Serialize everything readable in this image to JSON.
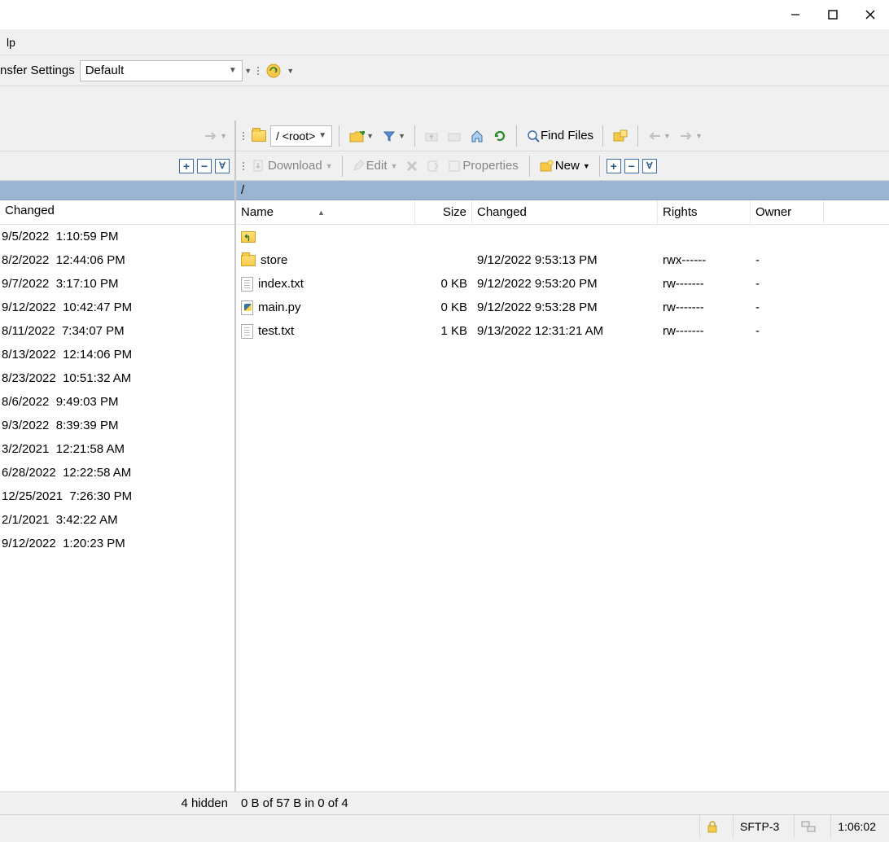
{
  "menu": {
    "help": "lp"
  },
  "toolbar": {
    "transfer_settings_label": "nsfer Settings",
    "transfer_settings_value": "Default"
  },
  "remote_nav": {
    "path_selector": "/ <root>",
    "find_files": "Find Files"
  },
  "remote_actions": {
    "download": "Download",
    "edit": "Edit",
    "properties": "Properties",
    "new": "New"
  },
  "remote_path": "/",
  "remote_columns": {
    "name": "Name",
    "size": "Size",
    "changed": "Changed",
    "rights": "Rights",
    "owner": "Owner"
  },
  "remote_files": [
    {
      "name": "..",
      "icon": "up",
      "size": "",
      "changed": "",
      "rights": "",
      "owner": ""
    },
    {
      "name": "store",
      "icon": "folder",
      "size": "",
      "changed": "9/12/2022 9:53:13 PM",
      "rights": "rwx------",
      "owner": "-"
    },
    {
      "name": "index.txt",
      "icon": "file",
      "size": "0 KB",
      "changed": "9/12/2022 9:53:20 PM",
      "rights": "rw-------",
      "owner": "-"
    },
    {
      "name": "main.py",
      "icon": "py",
      "size": "0 KB",
      "changed": "9/12/2022 9:53:28 PM",
      "rights": "rw-------",
      "owner": "-"
    },
    {
      "name": "test.txt",
      "icon": "file",
      "size": "1 KB",
      "changed": "9/13/2022 12:31:21 AM",
      "rights": "rw-------",
      "owner": "-"
    }
  ],
  "local_columns": {
    "changed": "Changed"
  },
  "local_files": [
    {
      "changed": "9/5/2022 1:10:59 PM"
    },
    {
      "changed": "8/2/2022 12:44:06 PM"
    },
    {
      "changed": "9/7/2022 3:17:10 PM"
    },
    {
      "changed": "9/12/2022 10:42:47 PM"
    },
    {
      "changed": "8/11/2022 7:34:07 PM"
    },
    {
      "changed": "8/13/2022 12:14:06 PM"
    },
    {
      "changed": "8/23/2022 10:51:32 AM"
    },
    {
      "changed": "8/6/2022 9:49:03 PM"
    },
    {
      "changed": "9/3/2022 8:39:39 PM"
    },
    {
      "changed": "3/2/2021 12:21:58 AM"
    },
    {
      "changed": "6/28/2022 12:22:58 AM"
    },
    {
      "changed": "12/25/2021 7:26:30 PM"
    },
    {
      "changed": "2/1/2021 3:42:22 AM"
    },
    {
      "changed": "9/12/2022 1:20:23 PM"
    }
  ],
  "status": {
    "left": "4 hidden",
    "right": "0 B of 57 B in 0 of 4",
    "protocol": "SFTP-3",
    "elapsed": "1:06:02"
  }
}
